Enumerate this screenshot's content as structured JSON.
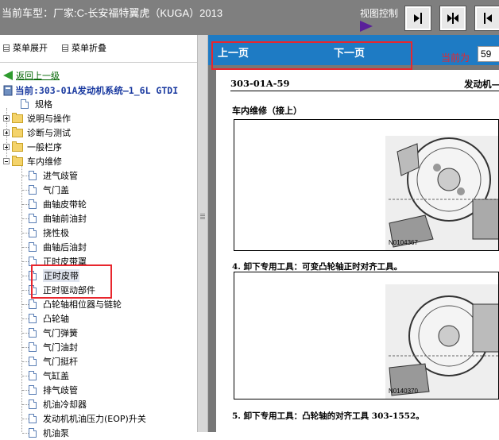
{
  "header": {
    "car_title": "当前车型：厂家:C-长安福特翼虎（KUGA）2013",
    "view_control": "视图控制"
  },
  "left_panel": {
    "menu_expand": "菜单展开",
    "menu_collapse": "菜单折叠",
    "back_link": "返回上一级",
    "current_path": "当前:303-01A发动机系统—1_6L GTDI",
    "tree": {
      "spec": "规格",
      "folders": [
        "说明与操作",
        "诊断与测试",
        "一般栏序",
        "车内维修"
      ],
      "items": [
        "进气歧管",
        "气门盖",
        "曲轴皮带轮",
        "曲轴前油封",
        "挠性极",
        "曲轴后油封",
        "正时皮带罩",
        "正时皮带",
        "正时驱动部件",
        "凸轮轴相位器与链轮",
        "凸轮轴",
        "气门弹簧",
        "气门油封",
        "气门挺杆",
        "气缸盖",
        "排气歧管",
        "机油冷却器",
        "发动机机油压力(EOP)升关",
        "机油泵"
      ]
    }
  },
  "right_panel": {
    "prev_page": "上一页",
    "next_page": "下一页",
    "current_page_label": "当前为",
    "current_page_value": "59",
    "page_code": "303-01A-59",
    "page_header": "发动机—",
    "section_title": "车内维修（接上）",
    "step4": "4. 卸下专用工具：可变凸轮轴正时对齐工具。",
    "step5": "5. 卸下专用工具：凸轮轴的对齐工具 303-1552。",
    "figure1_id": "N0104367",
    "figure2_id": "N0140370"
  }
}
